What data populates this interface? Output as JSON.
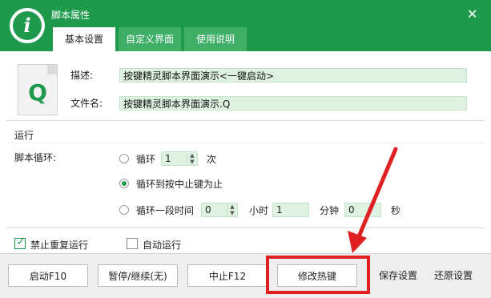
{
  "window": {
    "title": "脚本属性",
    "close_glyph": "✕"
  },
  "logo": {
    "glyph": "i"
  },
  "tabs": [
    {
      "label": "基本设置"
    },
    {
      "label": "自定义界面"
    },
    {
      "label": "使用说明"
    }
  ],
  "file_icon": {
    "glyph": "Q"
  },
  "description": {
    "label": "描述:",
    "value": "按键精灵脚本界面演示<一键启动>"
  },
  "filename": {
    "label": "文件名:",
    "value": "按键精灵脚本界面演示.Q"
  },
  "run": {
    "section_label": "运行",
    "loop_label": "脚本循环:",
    "option_loop": {
      "label": "循环",
      "value": "1",
      "unit": "次"
    },
    "option_until_stop": {
      "label": "循环到按中止键为止"
    },
    "option_duration": {
      "label": "循环一段时间",
      "hours": "0",
      "hours_unit": "小时",
      "minutes": "1",
      "minutes_unit": "分钟",
      "seconds": "0",
      "seconds_unit": "秒"
    }
  },
  "checks": {
    "no_repeat": {
      "label": "禁止重复运行",
      "checked": true
    },
    "auto_run": {
      "label": "自动运行",
      "checked": false
    }
  },
  "buttons": {
    "start": "启动F10",
    "pause": "暂停/继续(无)",
    "stop": "中止F12",
    "hotkey": "修改热键",
    "save": "保存设置",
    "restore": "还原设置"
  },
  "colors": {
    "brand": "#1f9a4c",
    "field_bg": "#dff1e0",
    "highlight": "#e02020"
  }
}
